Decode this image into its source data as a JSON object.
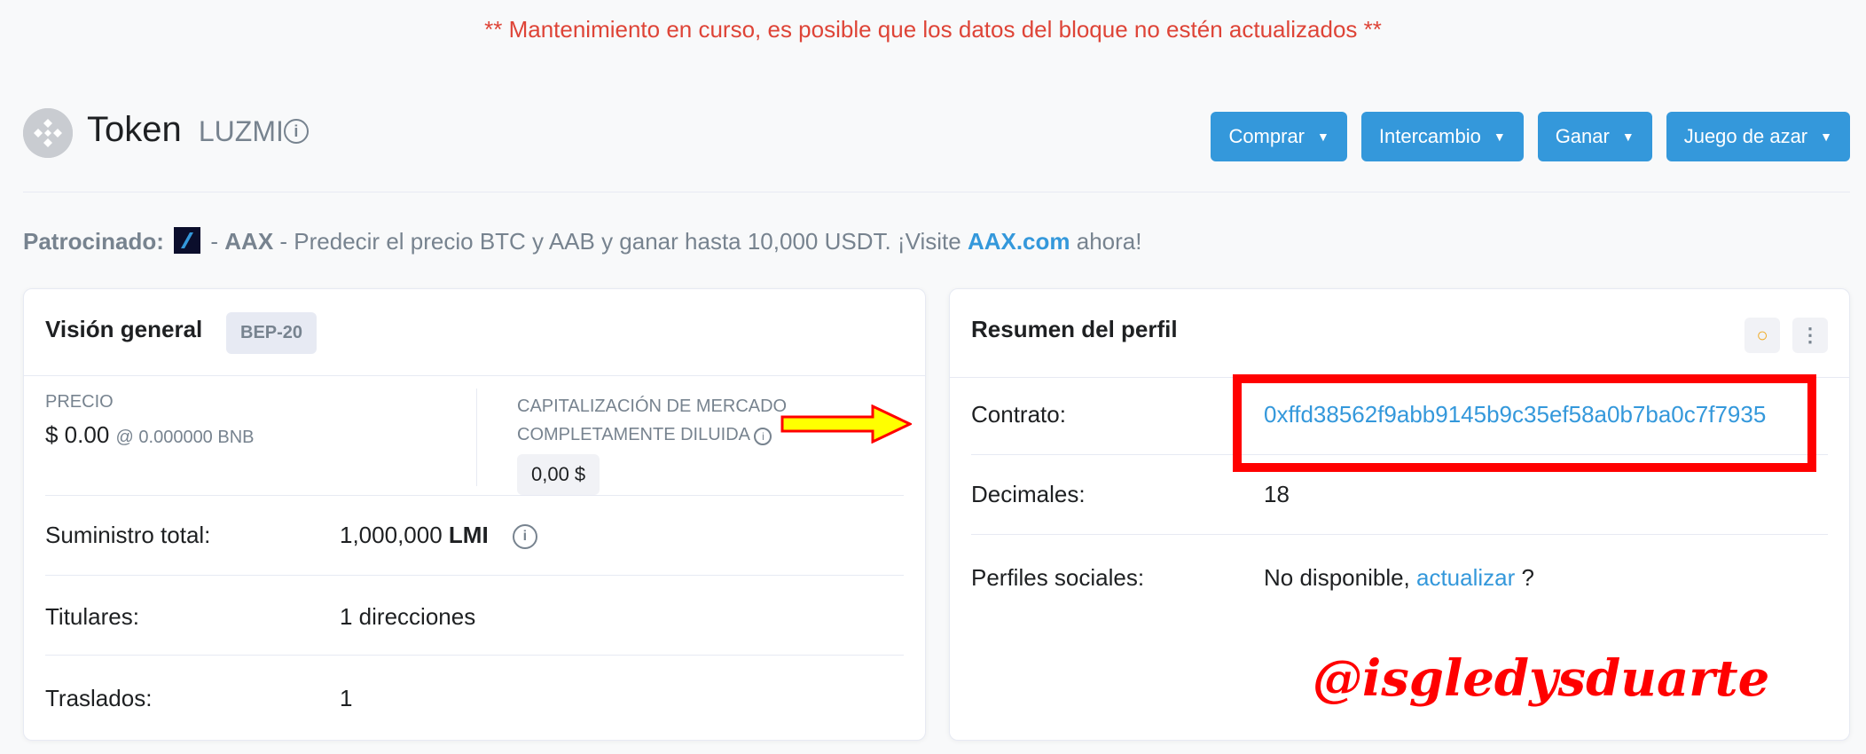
{
  "maintenance_notice": "** Mantenimiento en curso, es posible que los datos del bloque no estén actualizados **",
  "header": {
    "title": "Token",
    "token_name": "LUZMI",
    "buttons": [
      {
        "label": "Comprar"
      },
      {
        "label": "Intercambio"
      },
      {
        "label": "Ganar"
      },
      {
        "label": "Juego de azar"
      }
    ]
  },
  "sponsor": {
    "label": "Patrocinado:",
    "name": "AAX",
    "text": " - Predecir el precio BTC y AAB y ganar hasta 10,000 USDT. ¡Visite ",
    "link": "AAX.com",
    "suffix": " ahora!"
  },
  "overview": {
    "title": "Visión general",
    "badge": "BEP-20",
    "price_label": "PRECIO",
    "price_value": "$ 0.00",
    "price_bnb": "@ 0.000000 BNB",
    "mcap_label": "CAPITALIZACIÓN DE MERCADO COMPLETAMENTE DILUIDA",
    "mcap_value": "0,00 $",
    "supply_label": "Suministro total:",
    "supply_value": "1,000,000",
    "supply_symbol": "LMI",
    "holders_label": "Titulares:",
    "holders_value": "1 direcciones",
    "transfers_label": "Traslados:",
    "transfers_value": "1"
  },
  "profile": {
    "title": "Resumen del perfil",
    "contract_label": "Contrato:",
    "contract_value": "0xffd38562f9abb9145b9c35ef58a0b7ba0c7f7935",
    "decimals_label": "Decimales:",
    "decimals_value": "18",
    "social_label": "Perfiles sociales:",
    "social_value": "No disponible, ",
    "social_link": "actualizar",
    "social_suffix": " ?"
  },
  "watermark": "@isgledysduarte",
  "colors": {
    "accent": "#3498db",
    "alert": "#de4437",
    "highlight": "#ff0000",
    "arrow": "#ffff00"
  }
}
